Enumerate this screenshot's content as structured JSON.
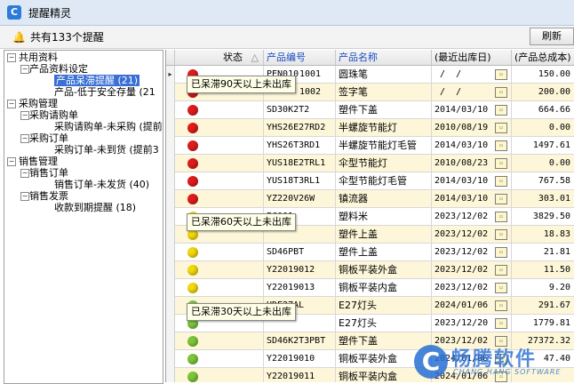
{
  "window": {
    "title": "提醒精灵",
    "app_icon": "app-logo-icon"
  },
  "toolbar": {
    "reminder_count_text": "共有133个提醒",
    "refresh_label": "刷新",
    "bell_icon": "bell-icon"
  },
  "tree": {
    "nodes": [
      {
        "label": "共用资料",
        "expander": "−"
      },
      {
        "label": "产品资料设定",
        "expander": "−"
      },
      {
        "label": "产品呆滞提醒 (21)",
        "selected": true
      },
      {
        "label": "产品-低于安全存量 (21"
      },
      {
        "label": "采购管理",
        "expander": "−"
      },
      {
        "label": "采购请购单",
        "expander": "−"
      },
      {
        "label": "采购请购单-未采购 (提前"
      },
      {
        "label": "采购订单",
        "expander": "−"
      },
      {
        "label": "采购订单-未到货 (提前3"
      },
      {
        "label": "销售管理",
        "expander": "−"
      },
      {
        "label": "销售订单",
        "expander": "−"
      },
      {
        "label": "销售订单-未发货 (40)"
      },
      {
        "label": "销售发票",
        "expander": "−"
      },
      {
        "label": "收款到期提醒 (18)"
      }
    ]
  },
  "grid": {
    "columns": [
      "状态",
      "产品编号",
      "产品名称",
      "(最近出库日)",
      "(产品总成本)"
    ],
    "sort_indicator": "△",
    "current_row_marker": "▸",
    "colors": {
      "red": "#e01b1b",
      "yellow": "#f2d90c",
      "green": "#7cc63a",
      "alt_row": "#fdf6d8"
    },
    "rows": [
      {
        "status": "red",
        "code": "PEN010",
        "code2": "1001",
        "name": "圆珠笔",
        "date": " /  / ",
        "cost": "150.00"
      },
      {
        "status": "red",
        "code": "",
        "code2": "1002",
        "name": "签字笔",
        "date": " /  / ",
        "cost": "200.00"
      },
      {
        "status": "red",
        "code": "SD30K2T2",
        "name": "塑件下盖",
        "date": "2014/03/10",
        "cost": "664.66"
      },
      {
        "status": "red",
        "code": "YHS26E27RD2",
        "name": "半螺旋节能灯",
        "date": "2010/08/19",
        "cost": "0.00"
      },
      {
        "status": "red",
        "code": "YHS26T3RD1",
        "name": "半螺旋节能灯毛管",
        "date": "2014/03/10",
        "cost": "1497.61"
      },
      {
        "status": "red",
        "code": "YUS18E2TRL1",
        "name": "伞型节能灯",
        "date": "2010/08/23",
        "cost": "0.00"
      },
      {
        "status": "red",
        "code": "YUS18T3RL1",
        "name": "伞型节能灯毛管",
        "date": "2014/03/10",
        "cost": "767.58"
      },
      {
        "status": "red",
        "code": "YZ220V26W",
        "name": "镇流器",
        "date": "2014/03/10",
        "cost": "303.01"
      },
      {
        "status": "yellow",
        "code": "PC001",
        "name": "塑料米",
        "date": "2023/12/02",
        "cost": "3829.50"
      },
      {
        "status": "yellow",
        "code": "",
        "name": "塑件上盖",
        "date": "2023/12/02",
        "cost": "18.83"
      },
      {
        "status": "yellow",
        "code": "SD46PBT",
        "name": "塑件上盖",
        "date": "2023/12/02",
        "cost": "21.81"
      },
      {
        "status": "yellow",
        "code": "Y22019012",
        "name": "铜板平装外盒",
        "date": "2023/12/02",
        "cost": "11.50"
      },
      {
        "status": "yellow",
        "code": "Y22019013",
        "name": "铜板平装内盒",
        "date": "2023/12/02",
        "cost": "9.20"
      },
      {
        "status": "green",
        "code": "HDE27AL",
        "name": "E27灯头",
        "date": "2024/01/06",
        "cost": "291.67"
      },
      {
        "status": "green",
        "code": "",
        "name": "E27灯头",
        "date": "2023/12/20",
        "cost": "1779.81"
      },
      {
        "status": "green",
        "code": "SD46K2T3PBT",
        "name": "塑件下盖",
        "date": "2023/12/02",
        "cost": "27372.32"
      },
      {
        "status": "green",
        "code": "Y22019010",
        "name": "铜板平装外盒",
        "date": "2024/01/06",
        "cost": "47.40"
      },
      {
        "status": "green",
        "code": "Y22019011",
        "name": "铜板平装内盒",
        "date": "2024/01/06",
        "cost": ""
      }
    ]
  },
  "tooltips": {
    "tip90": "已呆滞90天以上未出库",
    "tip60": "已呆滞60天以上未出库",
    "tip30": "已呆滞30天以上未出库"
  },
  "watermark": {
    "letter": "C",
    "text": "畅腾软件",
    "sub": "CHANG HANG SOFTWARE"
  }
}
